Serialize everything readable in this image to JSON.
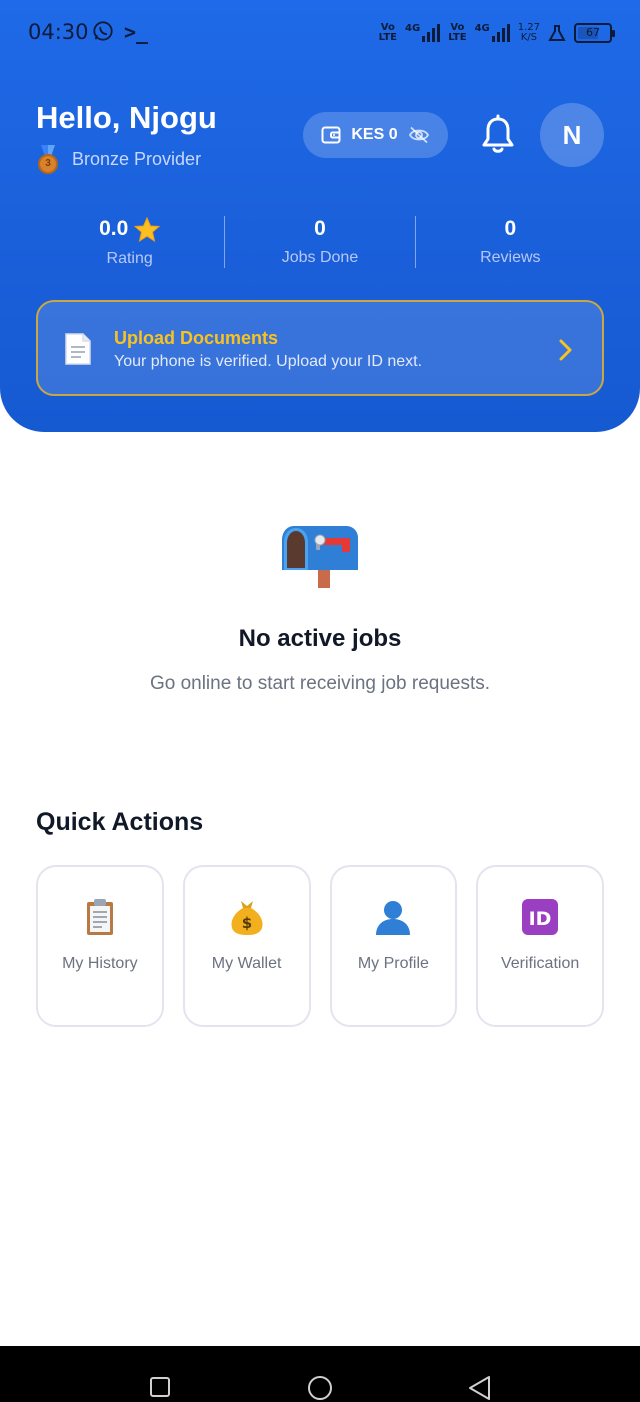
{
  "status_bar": {
    "time": "04:30",
    "terminal_glyph": ">_",
    "sim1": {
      "top": "Vo",
      "bottom": "LTE",
      "net": "4G"
    },
    "sim2": {
      "top": "Vo",
      "bottom": "LTE",
      "net": "4G"
    },
    "speed": {
      "value": "1.27",
      "unit": "K/S"
    },
    "battery": "67",
    "battery_level": 0.67
  },
  "header": {
    "greeting": "Hello, Njogu",
    "tier": "Bronze Provider",
    "tier_medal_number": "3",
    "wallet": {
      "label": "KES 0"
    },
    "avatar_initial": "N"
  },
  "stats": [
    {
      "value": "0.0",
      "label": "Rating",
      "icon": "star-icon"
    },
    {
      "value": "0",
      "label": "Jobs Done"
    },
    {
      "value": "0",
      "label": "Reviews"
    }
  ],
  "banner": {
    "title": "Upload Documents",
    "subtitle": "Your phone is verified. Upload your ID next."
  },
  "empty_state": {
    "icon": "mailbox-icon",
    "title": "No active jobs",
    "subtitle": "Go online to start receiving job requests."
  },
  "quick_actions": {
    "title": "Quick Actions",
    "items": [
      {
        "label": "My History",
        "icon": "clipboard-icon"
      },
      {
        "label": "My Wallet",
        "icon": "money-bag-icon"
      },
      {
        "label": "My Profile",
        "icon": "person-icon"
      },
      {
        "label": "Verification",
        "icon": "id-badge-icon"
      }
    ]
  },
  "colors": {
    "primary": "#1f6ae8",
    "banner_title": "#f9c21f",
    "banner_border": "#c9a843",
    "text_dark": "#111827",
    "text_muted": "#6b7280"
  }
}
